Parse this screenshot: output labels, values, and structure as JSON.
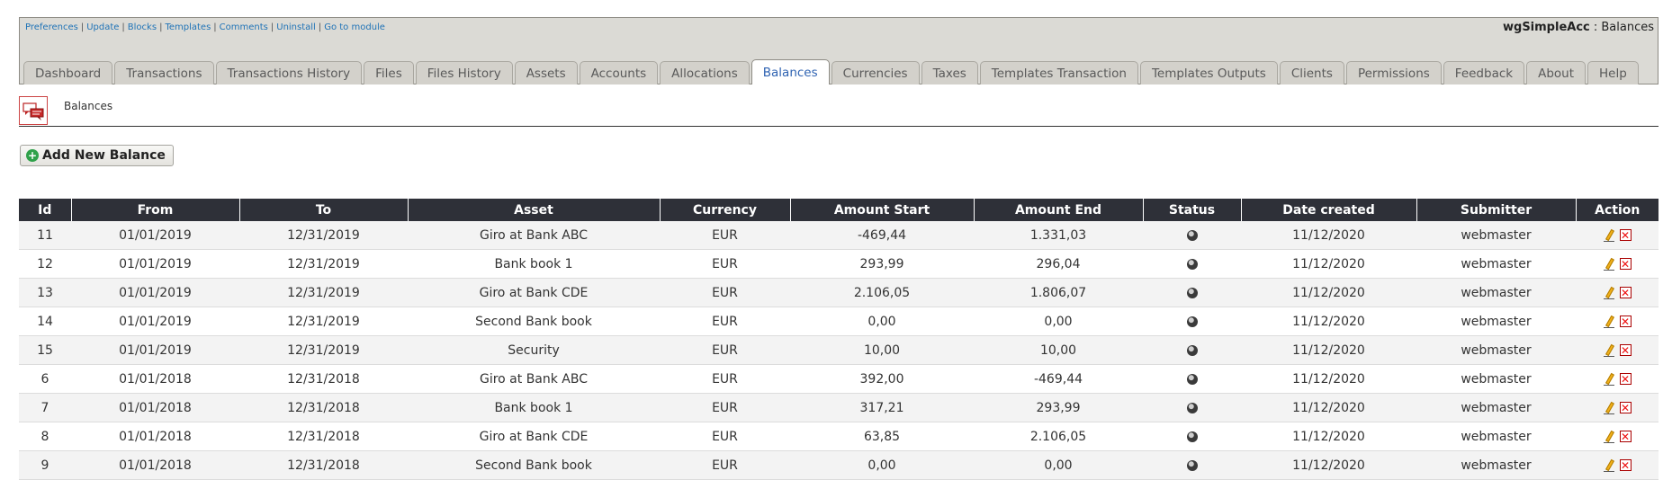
{
  "header": {
    "links": [
      {
        "label": "Preferences"
      },
      {
        "label": "Update"
      },
      {
        "label": "Blocks"
      },
      {
        "label": "Templates"
      },
      {
        "label": "Comments"
      },
      {
        "label": "Uninstall"
      },
      {
        "label": "Go to module"
      }
    ],
    "module_name": "wgSimpleAcc",
    "module_section": " : Balances"
  },
  "tabs": [
    {
      "label": "Dashboard"
    },
    {
      "label": "Transactions"
    },
    {
      "label": "Transactions History"
    },
    {
      "label": "Files"
    },
    {
      "label": "Files History"
    },
    {
      "label": "Assets"
    },
    {
      "label": "Accounts"
    },
    {
      "label": "Allocations"
    },
    {
      "label": "Balances",
      "active": true
    },
    {
      "label": "Currencies"
    },
    {
      "label": "Taxes"
    },
    {
      "label": "Templates Transaction"
    },
    {
      "label": "Templates Outputs"
    },
    {
      "label": "Clients"
    },
    {
      "label": "Permissions"
    },
    {
      "label": "Feedback"
    },
    {
      "label": "About"
    },
    {
      "label": "Help"
    }
  ],
  "page": {
    "title": "Balances",
    "icon": "comments-icon",
    "add_button_label": "Add New Balance"
  },
  "table": {
    "columns": [
      "Id",
      "From",
      "To",
      "Asset",
      "Currency",
      "Amount Start",
      "Amount End",
      "Status",
      "Date created",
      "Submitter",
      "Action"
    ],
    "rows": [
      {
        "id": "11",
        "from": "01/01/2019",
        "to": "12/31/2019",
        "asset": "Giro at Bank ABC",
        "currency": "EUR",
        "amount_start": "-469,44",
        "amount_end": "1.331,03",
        "date_created": "11/12/2020",
        "submitter": "webmaster"
      },
      {
        "id": "12",
        "from": "01/01/2019",
        "to": "12/31/2019",
        "asset": "Bank book 1",
        "currency": "EUR",
        "amount_start": "293,99",
        "amount_end": "296,04",
        "date_created": "11/12/2020",
        "submitter": "webmaster"
      },
      {
        "id": "13",
        "from": "01/01/2019",
        "to": "12/31/2019",
        "asset": "Giro at Bank CDE",
        "currency": "EUR",
        "amount_start": "2.106,05",
        "amount_end": "1.806,07",
        "date_created": "11/12/2020",
        "submitter": "webmaster"
      },
      {
        "id": "14",
        "from": "01/01/2019",
        "to": "12/31/2019",
        "asset": "Second Bank book",
        "currency": "EUR",
        "amount_start": "0,00",
        "amount_end": "0,00",
        "date_created": "11/12/2020",
        "submitter": "webmaster"
      },
      {
        "id": "15",
        "from": "01/01/2019",
        "to": "12/31/2019",
        "asset": "Security",
        "currency": "EUR",
        "amount_start": "10,00",
        "amount_end": "10,00",
        "date_created": "11/12/2020",
        "submitter": "webmaster"
      },
      {
        "id": "6",
        "from": "01/01/2018",
        "to": "12/31/2018",
        "asset": "Giro at Bank ABC",
        "currency": "EUR",
        "amount_start": "392,00",
        "amount_end": "-469,44",
        "date_created": "11/12/2020",
        "submitter": "webmaster"
      },
      {
        "id": "7",
        "from": "01/01/2018",
        "to": "12/31/2018",
        "asset": "Bank book 1",
        "currency": "EUR",
        "amount_start": "317,21",
        "amount_end": "293,99",
        "date_created": "11/12/2020",
        "submitter": "webmaster"
      },
      {
        "id": "8",
        "from": "01/01/2018",
        "to": "12/31/2018",
        "asset": "Giro at Bank CDE",
        "currency": "EUR",
        "amount_start": "63,85",
        "amount_end": "2.106,05",
        "date_created": "11/12/2020",
        "submitter": "webmaster"
      },
      {
        "id": "9",
        "from": "01/01/2018",
        "to": "12/31/2018",
        "asset": "Second Bank book",
        "currency": "EUR",
        "amount_start": "0,00",
        "amount_end": "0,00",
        "date_created": "11/12/2020",
        "submitter": "webmaster"
      }
    ]
  },
  "icons": {
    "status": "globe-icon",
    "edit": "pencil-icon",
    "delete": "delete-icon"
  }
}
